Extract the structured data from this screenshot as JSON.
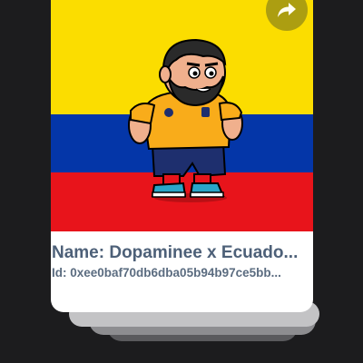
{
  "nft_card": {
    "name_label": "Name: ",
    "name_value": "Dopaminee x Ecuado...",
    "id_label": "Id: ",
    "id_value": "0xee0baf70db6dba05b94b97ce5bb..."
  },
  "colors": {
    "flag_yellow": "#fbdd00",
    "flag_blue": "#0436a8",
    "flag_red": "#e8141b",
    "text": "#4d6078",
    "share_button": "#a89a12"
  },
  "icons": {
    "share": "share-arrow-icon"
  }
}
